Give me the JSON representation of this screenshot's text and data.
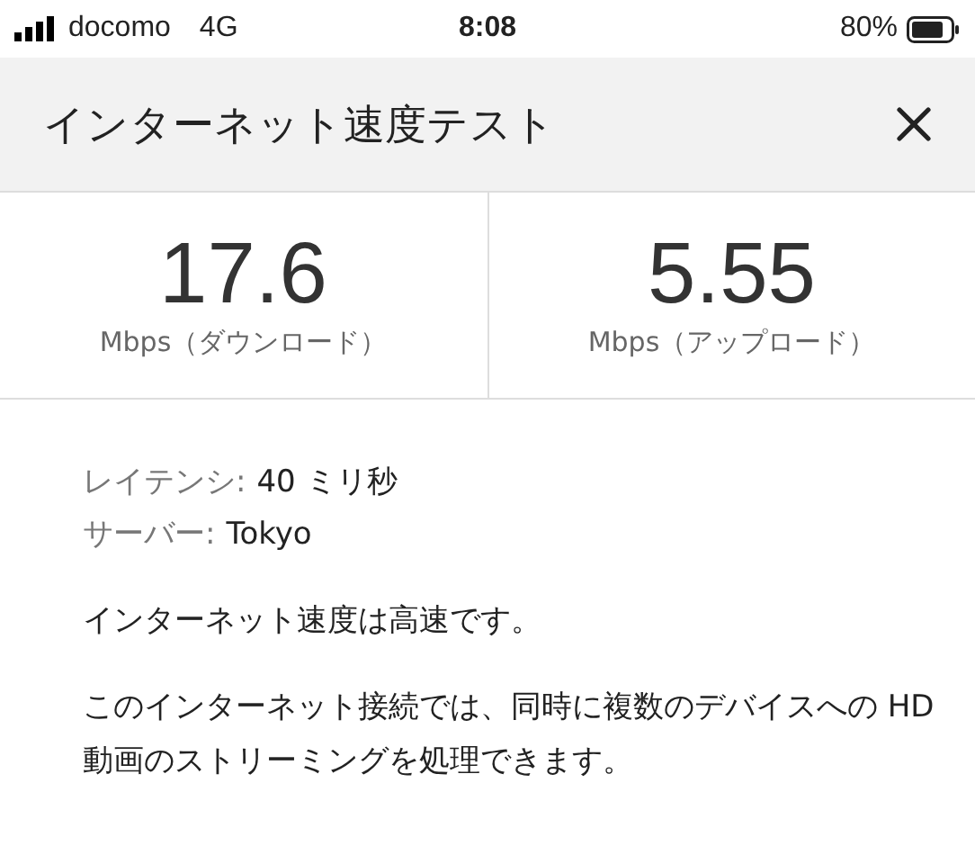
{
  "status_bar": {
    "carrier": "docomo",
    "network": "4G",
    "time": "8:08",
    "battery": "80%"
  },
  "header": {
    "title": "インターネット速度テスト"
  },
  "results": [
    {
      "value": "17.6",
      "unit": "Mbps（ダウンロード）"
    },
    {
      "value": "5.55",
      "unit": "Mbps（アップロード）"
    }
  ],
  "details": [
    {
      "label": "レイテンシ:",
      "value": "40 ミリ秒"
    },
    {
      "label": "サーバー:",
      "value": "Tokyo"
    }
  ],
  "paragraphs": [
    "インターネット速度は高速です。",
    "このインターネット接続では、同時に複数のデバイスへの HD 動画のストリーミングを処理できます。"
  ]
}
